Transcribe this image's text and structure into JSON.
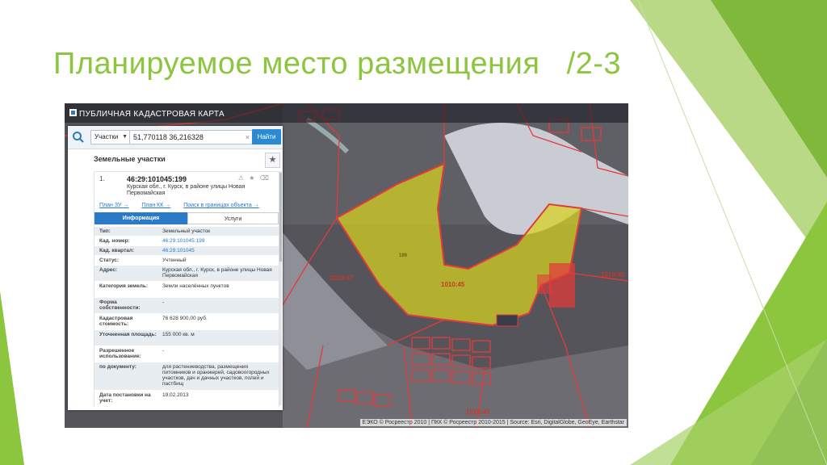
{
  "slide": {
    "title": "Планируемое место размещения   /2-3"
  },
  "map": {
    "app_title": "ПУБЛИЧНАЯ КАДАСТРОВАЯ КАРТА",
    "attribution": "ЕЭКО © Росреестр 2010 | ПКК © Росреестр 2010-2015 | Source: Esri, DigitalGlobe, GeoEye, Earthstar",
    "parcel_labels": [
      "1010:45",
      "1010:45",
      "1010:47",
      "1010:45",
      "199"
    ],
    "highlight_color": "#d8d21e",
    "boundary_color": "#e23b3b"
  },
  "panel": {
    "search": {
      "select_value": "Участки",
      "query": "51,770118 36,216328",
      "button": "Найти"
    },
    "section_title": "Земельные участки",
    "result": {
      "number": "1.",
      "cad_id": "46:29:101045:199",
      "address": "Курская обл., г. Курск, в районе улицы Новая Первомайская",
      "links": [
        "План ЗУ →",
        "План КК →",
        "Поиск в границах объекта →"
      ],
      "tabs": [
        "Информация",
        "Услуги"
      ],
      "rows": [
        {
          "k": "Тип:",
          "v": "Земельный участок"
        },
        {
          "k": "Кад. номер:",
          "v": "46:29:101045:199"
        },
        {
          "k": "Кад. квартал:",
          "v": "46:29:101045"
        },
        {
          "k": "Статус:",
          "v": "Учтенный"
        },
        {
          "k": "Адрес:",
          "v": "Курская обл., г. Курск, в районе улицы Новая Первомайская"
        },
        {
          "k": "Категория земель:",
          "v": "Земли населённых пунктов"
        },
        {
          "k": "Форма собственности:",
          "v": "-"
        },
        {
          "k": "Кадастровая стоимость:",
          "v": "76 628 900,00 руб."
        },
        {
          "k": "Уточненная площадь:",
          "v": "155 000 кв. м"
        },
        {
          "k": "Разрешенное использование:",
          "v": "-"
        },
        {
          "k": "по документу:",
          "v": "для растениеводства, размещения питомников и оранжерей, садовоогородных участков, дач и дачных участков, полей и пастбищ"
        },
        {
          "k": "Дата постановки на учет:",
          "v": "19.02.2013"
        }
      ]
    }
  }
}
